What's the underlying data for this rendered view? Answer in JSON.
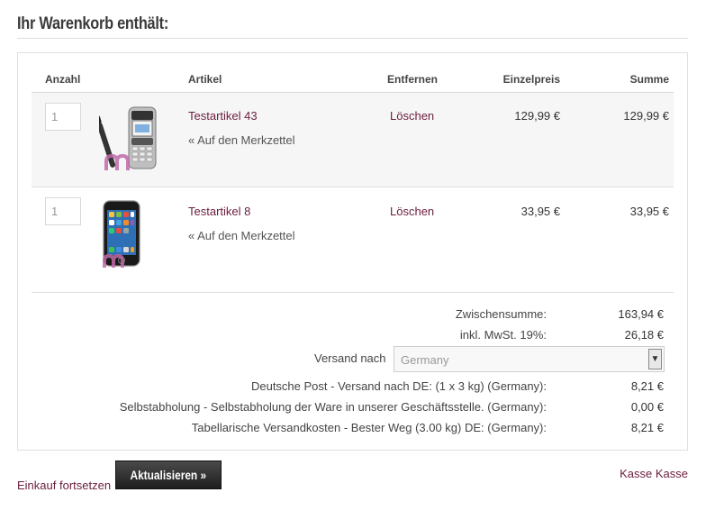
{
  "heading": "Ihr Warenkorb enthält:",
  "table": {
    "headers": {
      "anzahl": "Anzahl",
      "artikel": "Artikel",
      "entfernen": "Entfernen",
      "einzelpreis": "Einzelpreis",
      "summe": "Summe"
    },
    "rows": [
      {
        "qty": "1",
        "name": "Testartikel 43",
        "wishlist": "« Auf den Merkzettel",
        "remove": "Löschen",
        "price": "129,99 €",
        "sum": "129,99 €",
        "icon": "nokia-phone-image"
      },
      {
        "qty": "1",
        "name": "Testartikel 8",
        "wishlist": "« Auf den Merkzettel",
        "remove": "Löschen",
        "price": "33,95 €",
        "sum": "33,95 €",
        "icon": "smartphone-image"
      }
    ]
  },
  "totals": {
    "subtotal_label": "Zwischensumme:",
    "subtotal_value": "163,94 €",
    "tax_label": "inkl. MwSt. 19%:",
    "tax_value": "26,18 €",
    "shipping_to_label": "Versand nach",
    "shipping_country": "Germany",
    "methods": [
      {
        "label": "Deutsche Post - Versand nach DE: (1 x 3 kg) (Germany):",
        "value": "8,21 €"
      },
      {
        "label": "Selbstabholung - Selbstabholung der Ware in unserer Geschäftsstelle. (Germany):",
        "value": "0,00 €"
      },
      {
        "label": "Tabellarische Versandkosten - Bester Weg (3.00 kg) DE: (Germany):",
        "value": "8,21 €"
      }
    ]
  },
  "actions": {
    "continue": "Einkauf fortsetzen",
    "update": "Aktualisieren »",
    "checkout": "Kasse Kasse"
  },
  "colors": {
    "link": "#6b1d3e",
    "brand_logo": "#c06aa8"
  }
}
